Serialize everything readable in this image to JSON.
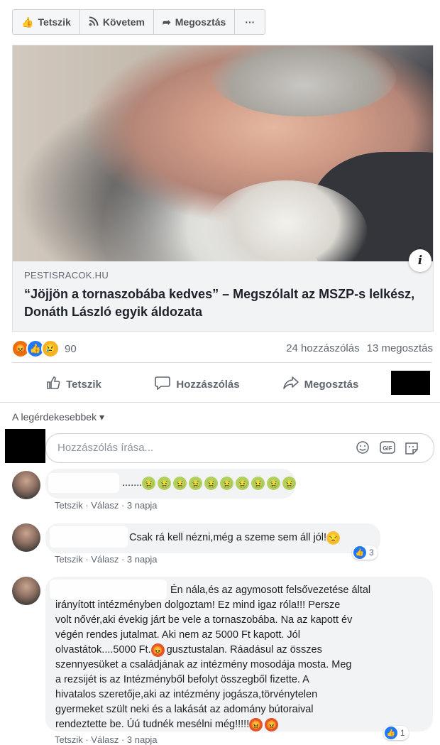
{
  "page_actions": {
    "like": "Tetszik",
    "follow": "Követem",
    "share": "Megosztás",
    "more": "···"
  },
  "link_card": {
    "domain": "PESTISRACOK.HU",
    "title": "“Jöjjön a tornaszobába kedves” – Megszólalt az MSZP-s lelkész, Donáth László egyik áldozata",
    "info_icon": "i"
  },
  "reactions": {
    "count": "90",
    "comments": "24 hozzászólás",
    "shares": "13 megosztás"
  },
  "post_actions": {
    "like": "Tetszik",
    "comment": "Hozzászólás",
    "share": "Megosztás"
  },
  "sort_label": "A legérdekesebbek ▾",
  "comment_input": {
    "placeholder": "Hozzászólás írása...",
    "gif": "GIF"
  },
  "comments": [
    {
      "text": ".......",
      "meta_like": "Tetszik",
      "meta_reply": "Válasz",
      "meta_time": "3 napja"
    },
    {
      "text": "Csak rá kell nézni,még a szeme sem áll jól!",
      "reaction_count": "3",
      "meta_like": "Tetszik",
      "meta_reply": "Válasz",
      "meta_time": "3 napja"
    },
    {
      "line1": "Én nála,és az agymosott felsővezetése által",
      "line2": "irányított intézményben dolgoztam! Ez mind igaz róla!!! Persze",
      "line3": "volt nővér,aki évekig járt be vele a tornaszobába. Na az kapott év",
      "line4": "végén rendes jutalmat. Aki nem az 5000 Ft kapott. Jól",
      "line5a": "olvastátok....5000 Ft.",
      "line5b": "gusztustalan. Ráadásul az összes",
      "line6": "szennyesüket a családjának az intézmény mosodája mosta. Meg",
      "line7": "a rezsijét is az Intézményből befolyt összegből fizette. A",
      "line8": "hivatalos szeretője,aki az intézmény jogásza,törvénytelen",
      "line9": "gyermeket szült neki és a lakását az adomány bútoraival",
      "line10": "rendeztette be. Úú tudnék mesélni még!!!!!",
      "reaction_count": "1",
      "meta_like": "Tetszik",
      "meta_reply": "Válasz",
      "meta_time": "3 napja"
    }
  ]
}
